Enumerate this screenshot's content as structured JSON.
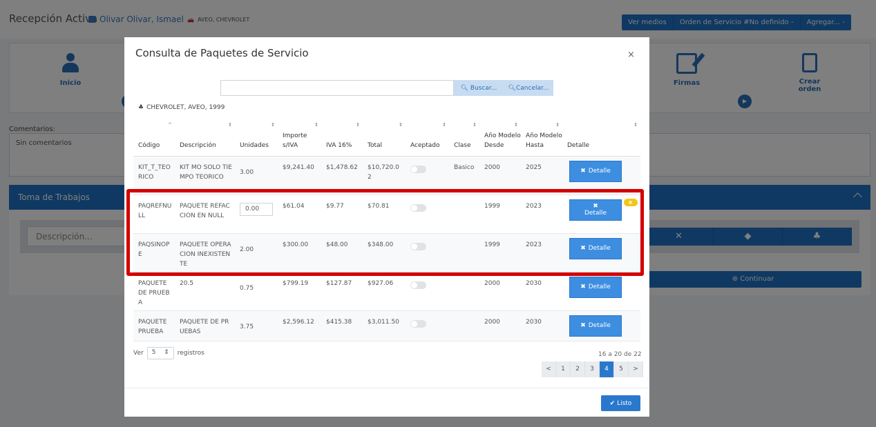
{
  "app": {
    "title": "Recepción Activa",
    "client_name": "Olivar Olivar, Ismael",
    "client_vehicle": "AVEO, CHEVROLET",
    "top_buttons": [
      "Ver medios",
      "Orden de Servicio #No definido -",
      "Agregar... -"
    ],
    "steps": [
      {
        "label": "Inicio",
        "icon": "person-icon"
      },
      {
        "label": "Firmas",
        "icon": "signature-icon"
      },
      {
        "label": "Crear orden",
        "icon": "document-icon"
      }
    ],
    "comments_label": "Comentarios:",
    "comments_value": "Sin comentarios",
    "work_title": "Toma de Trabajos",
    "description_placeholder": "Descripción...",
    "continue_label": "Continuar"
  },
  "modal": {
    "title": "Consulta de Paquetes de Servicio",
    "close_symbol": "×",
    "search_value": "",
    "search_label": "Buscar...",
    "cancel_label": "Cancelar...",
    "vehicle": "CHEVROLET, AVEO, 1999",
    "columns": [
      "Código",
      "Descripción",
      "Unidades",
      "Importe s/IVA",
      "IVA 16%",
      "Total",
      "Aceptado",
      "Clase",
      "Año Modelo Desde",
      "Año Modelo Hasta",
      "Detalle"
    ],
    "rows": [
      {
        "code": "KIT_T_TEORICO",
        "description": "KIT MO SOLO TIEMPO TEORICO",
        "units": "3.00",
        "importe": "$9,241.40",
        "iva": "$1,478.62",
        "total": "$10,720.02",
        "class": "Basico",
        "desde": "2000",
        "hasta": "2025",
        "detail": "Detalle"
      },
      {
        "code": "PAQREFNULL",
        "description": "PAQUETE REFACCION EN NULL",
        "units": "0.00",
        "importe": "$61.04",
        "iva": "$9.77",
        "total": "$70.81",
        "class": "",
        "desde": "1999",
        "hasta": "2023",
        "detail": "Detalle"
      },
      {
        "code": "PAQSINOPE",
        "description": "PAQUETE OPERACION INEXISTENTE",
        "units": "2.00",
        "importe": "$300.00",
        "iva": "$48.00",
        "total": "$348.00",
        "class": "",
        "desde": "1999",
        "hasta": "2023",
        "detail": "Detalle"
      },
      {
        "code": "PAQUETE DE PRUEBA",
        "description": "20.5",
        "units": "0.75",
        "importe": "$799.19",
        "iva": "$127.87",
        "total": "$927.06",
        "class": "",
        "desde": "2000",
        "hasta": "2030",
        "detail": "Detalle"
      },
      {
        "code": "PAQUETE PRUEBA",
        "description": "PAQUETE DE PRUEBAS",
        "units": "3.75",
        "importe": "$2,596.12",
        "iva": "$415.38",
        "total": "$3,011.50",
        "class": "",
        "desde": "2000",
        "hasta": "2030",
        "detail": "Detalle"
      }
    ],
    "ver_label": "Ver",
    "page_size": "5",
    "registros_label": "registros",
    "page_info": "16 a 20 de 22",
    "pages": [
      "<",
      "1",
      "2",
      "3",
      "4",
      "5",
      ">"
    ],
    "active_page": "4",
    "done_label": "Listo"
  }
}
